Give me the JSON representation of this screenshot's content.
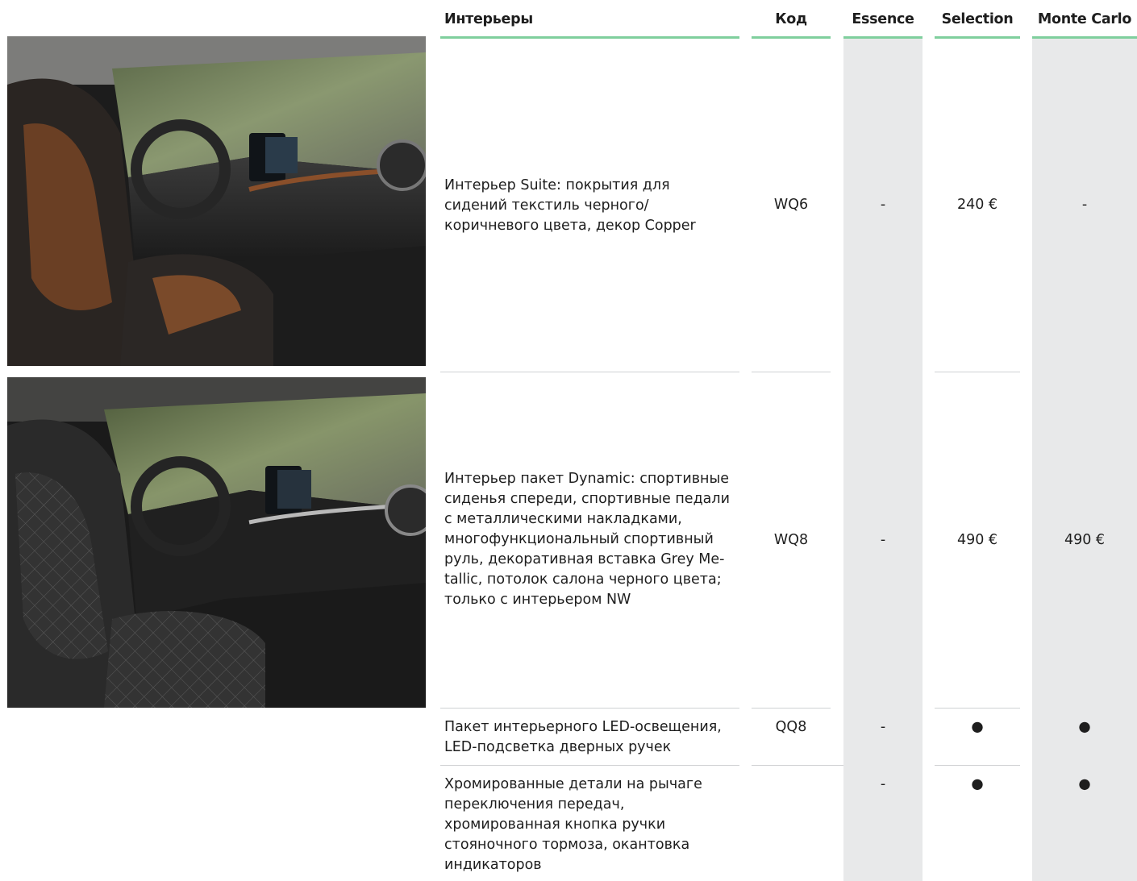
{
  "headers": {
    "interiors": "Интерьеры",
    "code": "Код",
    "essence": "Essence",
    "selection": "Selection",
    "monte_carlo": "Monte Carlo"
  },
  "rows": [
    {
      "description": "Интерьер Suite: покрытия для сидений текстиль черного/ коричневого цвета, декор Copper",
      "code": "WQ6",
      "essence": "-",
      "selection": "240 €",
      "monte_carlo": "-"
    },
    {
      "description": "Интерьер пакет Dynamic: спортивные сиденья спереди, спортивные педали с металлическими накладками, многофункциональный спортивный руль, декоративная вставка Grey Me-tallic, потолок салона черного цвета; только с интерьером NW",
      "code": "WQ8",
      "essence": "-",
      "selection": "490 €",
      "monte_carlo": "490 €"
    },
    {
      "description": "Пакет интерьерного LED-освещения, LED-подсветка дверных ручек",
      "code": "QQ8",
      "essence": "-",
      "selection": "●",
      "monte_carlo": "●"
    },
    {
      "description": "Хромированные детали на рычаге переключения передач, хромированная кнопка ручки стояночного тормоза, окантовка индикаторов",
      "code": "",
      "essence": "-",
      "selection": "●",
      "monte_carlo": "●"
    }
  ],
  "colors": {
    "accent_green": "#7fcf9d",
    "column_grey": "#e8e9ea",
    "separator": "#cfd1d3"
  }
}
